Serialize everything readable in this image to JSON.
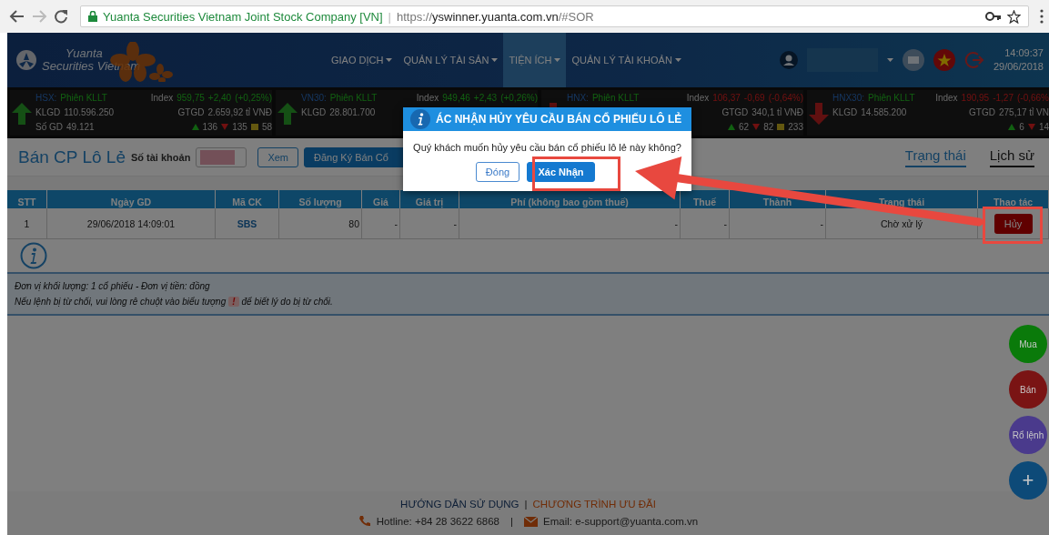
{
  "browser": {
    "site": "Yuanta Securities Vietnam Joint Stock Company [VN]",
    "separator": "|",
    "url_scheme": "https://",
    "url_host": "yswinner.yuanta.com.vn",
    "url_path": "/#SOR"
  },
  "header": {
    "logo_top": "Yuanta",
    "logo_bottom": "Securities Vietnam",
    "nav": [
      {
        "label": "GIAO DỊCH",
        "selected": false
      },
      {
        "label": "QUẢN LÝ TÀI SẢN",
        "selected": false
      },
      {
        "label": "TIỆN ÍCH",
        "selected": true
      },
      {
        "label": "QUẢN LÝ TÀI KHOẢN",
        "selected": false
      }
    ],
    "time": "14:09:37",
    "date": "29/06/2018"
  },
  "ticker": [
    {
      "exchange": "HSX:",
      "session": "Phiên KLLT",
      "rising": true,
      "index_label": "Index",
      "index": "959,75",
      "change": "+2,40",
      "percent": "(+0,25%)",
      "stats": [
        {
          "label": "KLGD",
          "value": "110.596.250"
        },
        {
          "label": "Số GD",
          "value": "49.121"
        }
      ],
      "value_stat": {
        "label": "GTGD",
        "value": "2.659,92 tỉ VNĐ"
      },
      "counts": {
        "up": "136",
        "down": "135",
        "flat": "58"
      }
    },
    {
      "exchange": "VN30:",
      "session": "Phiên KLLT",
      "rising": true,
      "index_label": "Index",
      "index": "949,46",
      "change": "+2,43",
      "percent": "(+0,26%)",
      "stats": [
        {
          "label": "KLGD",
          "value": "28.801.700"
        }
      ]
    },
    {
      "exchange": "HNX:",
      "session": "Phiên KLLT",
      "rising": false,
      "index_label": "Index",
      "index": "106,37",
      "change": "-0,69",
      "percent": "(-0,64%)",
      "value_stat": {
        "label": "GTGD",
        "value": "340,1 tỉ VNĐ"
      },
      "counts": {
        "up": "62",
        "down": "82",
        "flat": "233"
      }
    },
    {
      "exchange": "HNX30:",
      "session": "Phiên KLLT",
      "rising": false,
      "index_label": "Index",
      "index": "190,95",
      "change": "-1,27",
      "percent": "(-0,66%",
      "stats": [
        {
          "label": "KLGD",
          "value": "14.585.200"
        }
      ],
      "value_stat": {
        "label": "GTGD",
        "value": "275,17 tỉ VN"
      },
      "counts": {
        "up": "6",
        "down": "14"
      }
    }
  ],
  "page": {
    "title": "Bán CP Lô Lẻ",
    "account_label": "Số tài khoản",
    "buttons": [
      {
        "label": "Xem",
        "kind": "outline"
      },
      {
        "label": "Đăng Ký Bán Cổ",
        "kind": "primary"
      }
    ],
    "tabs": [
      {
        "label": "Trạng thái",
        "selected": true
      },
      {
        "label": "Lịch sử",
        "selected": false
      }
    ]
  },
  "table": {
    "columns": [
      "STT",
      "Ngày GD",
      "Mã CK",
      "Số lượng",
      "Giá",
      "Giá trị",
      "Phí (không bao gồm thuế)",
      "Thuế",
      "Thành",
      "Trạng thái",
      "Thao tác"
    ],
    "rows": [
      {
        "cells": [
          "1",
          "29/06/2018 14:09:01",
          "SBS",
          "80",
          "-",
          "-",
          "-",
          "-",
          "-",
          "Chờ xử lý"
        ],
        "action": "Hủy"
      }
    ]
  },
  "notes": [
    {
      "text": "Đơn vị khối lượng: 1 cổ phiếu - Đơn vị tiền: đồng"
    },
    {
      "text": "Nếu lệnh bị từ chối, vui lòng rê chuột vào biểu tượng",
      "icon": "!",
      "after": "để biết lý do bị từ chối."
    }
  ],
  "fabs": [
    {
      "label": "Mua",
      "color": "#0a7a0a"
    },
    {
      "label": "Bán",
      "color": "#7a1414"
    },
    {
      "label": "Rổ lệnh",
      "color": "#4a3a8c"
    },
    {
      "label": "+",
      "color": "#0d4a78"
    }
  ],
  "footer": {
    "links": [
      {
        "label": "HƯỚNG DẪN SỬ DỤNG",
        "kind": "guide"
      },
      {
        "label": "CHƯƠNG TRÌNH ƯU ĐÃI",
        "kind": "promo"
      }
    ],
    "separator": "|",
    "hotline": "Hotline: +84 28 3622 6868",
    "contact_separator": "|",
    "email": "Email: e-support@yuanta.com.vn"
  },
  "modal": {
    "title": "ÁC NHẬN HỦY YÊU CẦU BÁN CỔ PHIẾU LÔ LẺ",
    "message": "Quý khách muốn hủy yêu cầu bán cổ phiếu lô lẻ này không?",
    "buttons": [
      {
        "label": "Đóng",
        "kind": "secondary"
      },
      {
        "label": "Xác Nhận",
        "kind": "primary"
      }
    ]
  }
}
